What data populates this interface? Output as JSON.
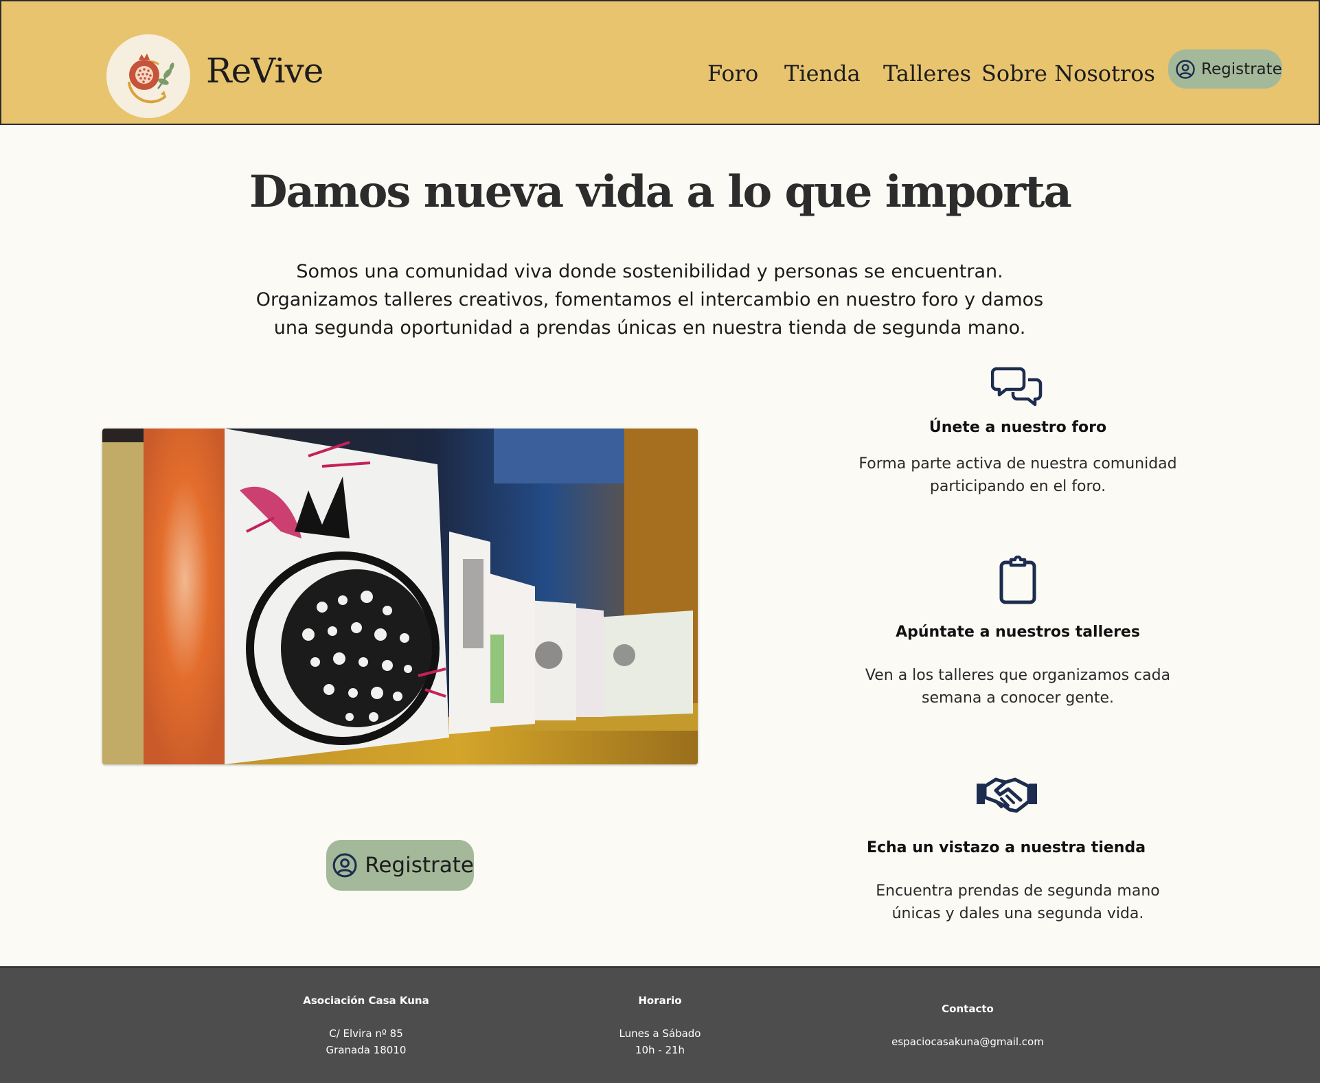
{
  "header": {
    "brand": "ReVive",
    "nav": [
      "Foro",
      "Tienda",
      "Talleres",
      "Sobre Nosotros"
    ],
    "register_label": "Registrate"
  },
  "hero": {
    "title": "Damos nueva vida a lo que importa",
    "intro_lines": [
      "Somos una comunidad viva donde sostenibilidad y personas se encuentran.",
      "Organizamos talleres creativos, fomentamos el intercambio en nuestro foro y damos",
      "una segunda oportunidad a prendas únicas en nuestra tienda de segunda mano."
    ],
    "register_label": "Registrate"
  },
  "features": [
    {
      "icon": "chat-bubbles-icon",
      "title": "Únete a nuestro foro",
      "text_lines": [
        "Forma parte activa de nuestra comunidad",
        "participando en el foro."
      ]
    },
    {
      "icon": "clipboard-icon",
      "title": "Apúntate a nuestros talleres",
      "text_lines": [
        "Ven a los talleres que organizamos cada",
        "semana a conocer gente."
      ]
    },
    {
      "icon": "handshake-icon",
      "title": "Echa un vistazo a nuestra tienda",
      "text_lines": [
        "Encuentra prendas de segunda mano",
        "únicas y dales una segunda vida."
      ]
    }
  ],
  "footer": {
    "org": {
      "heading": "Asociación Casa Kuna",
      "lines": [
        "C/ Elvira nº 85",
        "Granada 18010"
      ]
    },
    "hours": {
      "heading": "Horario",
      "lines": [
        "Lunes a Sábado",
        "10h - 21h"
      ]
    },
    "contact": {
      "heading": "Contacto",
      "lines": [
        "espaciocasakuna@gmail.com"
      ]
    }
  },
  "colors": {
    "header_bg": "#e8c46f",
    "page_bg": "#fbfaf4",
    "button_bg": "#a4b99a",
    "icon": "#1d2d4f",
    "footer_bg": "#4d4d4d"
  }
}
